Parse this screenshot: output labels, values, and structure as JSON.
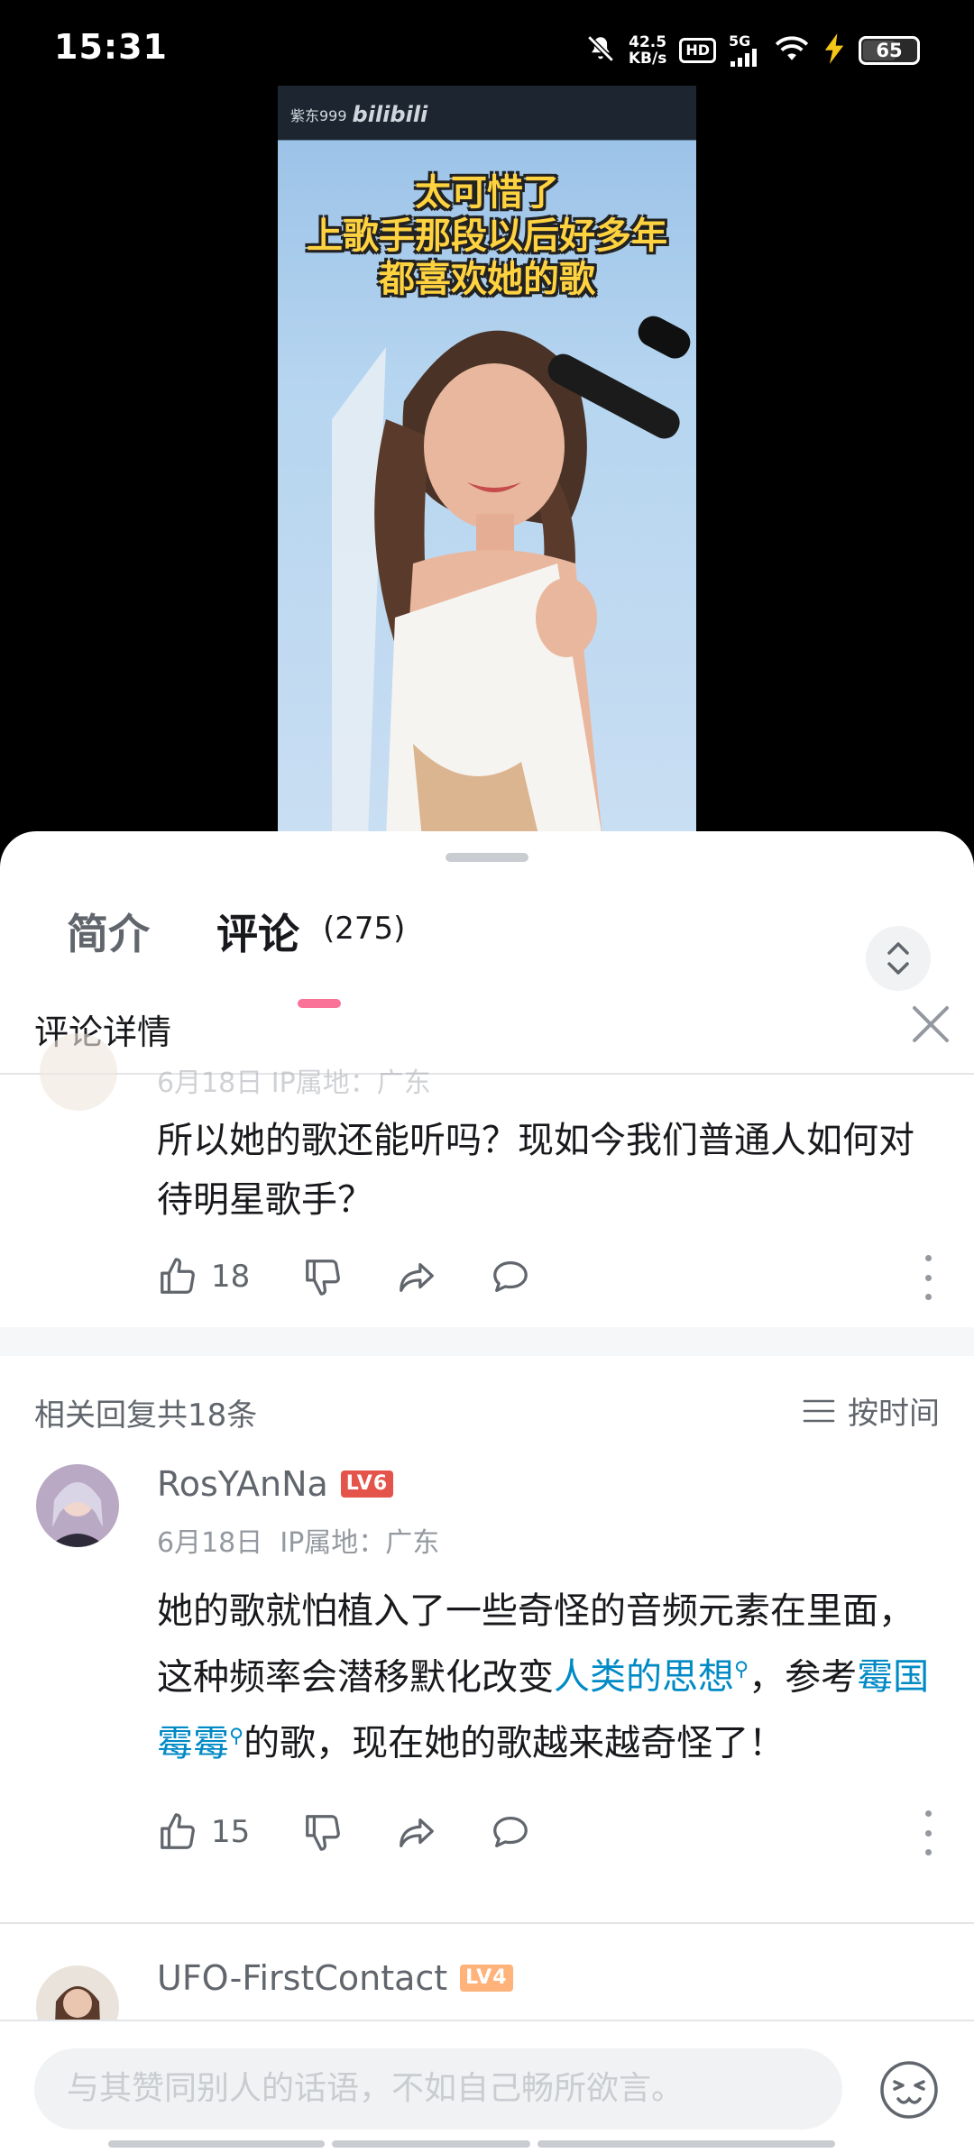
{
  "status_bar": {
    "time": "15:31",
    "net_speed_value": "42.5",
    "net_speed_unit": "KB/s",
    "hd": "HD",
    "network": "5G",
    "battery": "65",
    "icons": [
      "mute-icon",
      "signal-icon",
      "wifi-icon",
      "charging-icon",
      "battery-icon"
    ]
  },
  "video": {
    "watermark_user": "紫东999",
    "watermark_brand": "bilibili",
    "caption_lines": [
      "太可惜了",
      "上歌手那段以后好多年",
      "都喜欢她的歌"
    ]
  },
  "tabs": {
    "intro": "简介",
    "comments": "评论",
    "comments_count": "(275)"
  },
  "detail": {
    "title": "评论详情"
  },
  "parent_comment": {
    "faded_meta": "6月18日  IP属地：广东",
    "text": "所以她的歌还能听吗？现如今我们普通人如何对待明星歌手？",
    "likes": "18"
  },
  "replies_header": {
    "count_label": "相关回复共18条",
    "sort_label": "按时间"
  },
  "replies": [
    {
      "username": "RosYAnNa",
      "level": "LV6",
      "level_color": "#e5544b",
      "date": "6月18日",
      "ip": "IP属地：广东",
      "text_part1": "她的歌就怕植入了一些奇怪的音频元素在里面，这种频率会潜移默化改变",
      "link1": "人类的思想",
      "text_part2": "，参考",
      "link2": "霉国霉霉",
      "text_part3": "的歌，现在她的歌越来越奇怪了！",
      "likes": "15"
    },
    {
      "username": "UFO-FirstContact",
      "level": "LV4",
      "level_color": "#ffb27a"
    }
  ],
  "input": {
    "placeholder": "与其赞同别人的话语，不如自己畅所欲言。"
  },
  "colors": {
    "accent": "#fb7299",
    "link": "#008ac5"
  }
}
